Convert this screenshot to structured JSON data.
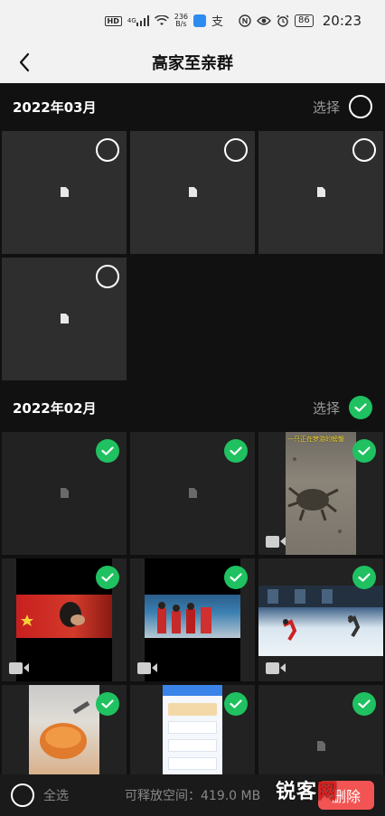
{
  "status_bar": {
    "hd": "HD",
    "signal": "4G",
    "speed_value": "236",
    "speed_unit": "B/s",
    "battery": "86",
    "time": "20:23"
  },
  "header": {
    "title": "高家至亲群"
  },
  "sections": [
    {
      "date": "2022年03月",
      "select_label": "选择",
      "selected": false,
      "items": [
        {
          "kind": "file",
          "selected": false
        },
        {
          "kind": "file",
          "selected": false
        },
        {
          "kind": "file",
          "selected": false
        },
        {
          "kind": "file",
          "selected": false
        }
      ]
    },
    {
      "date": "2022年02月",
      "select_label": "选择",
      "selected": true,
      "items": [
        {
          "kind": "file",
          "selected": true
        },
        {
          "kind": "file",
          "selected": true
        },
        {
          "kind": "video",
          "selected": true,
          "caption": "一只正在梦游的螃蟹"
        },
        {
          "kind": "video",
          "selected": true
        },
        {
          "kind": "video",
          "selected": true
        },
        {
          "kind": "video",
          "selected": true
        },
        {
          "kind": "image",
          "selected": true
        },
        {
          "kind": "image",
          "selected": true
        },
        {
          "kind": "file",
          "selected": true
        }
      ]
    }
  ],
  "bottom_bar": {
    "select_all_label": "全选",
    "free_space": "可释放空间：419.0 MB",
    "delete_label": "删除"
  },
  "watermark": {
    "text_a": "锐客",
    "text_b": "网"
  },
  "colors": {
    "accent_green": "#1fc160",
    "delete_red": "#f25454",
    "background": "#111111"
  }
}
